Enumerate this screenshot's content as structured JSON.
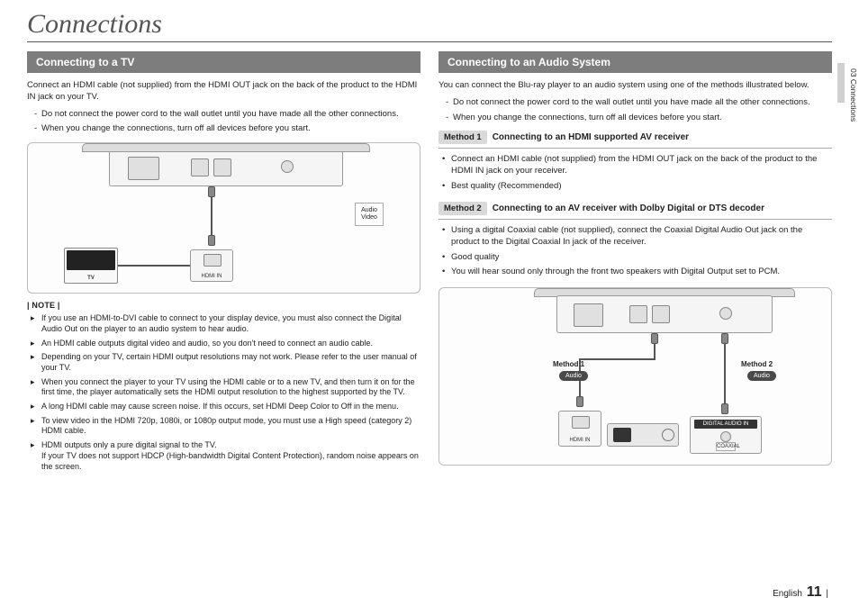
{
  "title": "Connections",
  "side_tab": "03  Connections",
  "footer": {
    "lang": "English",
    "page": "11",
    "bar": "|"
  },
  "left": {
    "header": "Connecting to a TV",
    "intro": "Connect an HDMI cable (not supplied) from the HDMI OUT jack on the back of the product to the HDMI IN jack on your TV.",
    "dashes": [
      "Do not connect the power cord to the wall outlet until you have made all the other connections.",
      "When you change the connections, turn off all devices before you start."
    ],
    "diagram": {
      "audio_video": "Audio\nVideo",
      "tv_label": "TV",
      "hdmi_in": "HDMI IN"
    },
    "note_label": "| NOTE |",
    "notes": [
      "If you use an HDMI-to-DVI cable to connect to your display device, you must also connect the Digital Audio Out on the player to an audio system to hear audio.",
      "An HDMI cable outputs digital video and audio, so you don't need to connect an audio cable.",
      "Depending on your TV, certain HDMI output resolutions may not work. Please refer to the user manual of your TV.",
      "When you connect the player to your TV using the HDMI cable or to a new TV, and then turn it on for the first time, the player automatically sets the HDMI output resolution to the highest supported by the TV.",
      "A long HDMI cable may cause screen noise. If this occurs, set HDMI Deep Color to Off in the menu.",
      "To view video in the HDMI 720p, 1080i, or 1080p output mode, you must use a High speed (category 2) HDMI cable.",
      "HDMI outputs only a pure digital signal to the TV.\nIf your TV does not support HDCP (High-bandwidth Digital Content Protection), random noise appears on the screen."
    ]
  },
  "right": {
    "header": "Connecting to an Audio System",
    "intro": "You can connect the Blu-ray player to an audio system using one of the methods illustrated below.",
    "dashes": [
      "Do not connect the power cord to the wall outlet until you have made all the other connections.",
      "When you change the connections, turn off all devices before you start."
    ],
    "method1": {
      "badge": "Method 1",
      "title": "Connecting to an HDMI supported AV receiver",
      "bullets": [
        "Connect an HDMI cable (not supplied) from the HDMI OUT jack on the back of the product to the HDMI IN jack on your receiver.",
        "Best quality (Recommended)"
      ]
    },
    "method2": {
      "badge": "Method 2",
      "title": "Connecting to an AV receiver with Dolby Digital or DTS decoder",
      "bullets": [
        "Using a digital Coaxial cable (not supplied), connect the Coaxial Digital Audio Out jack on the product to the Digital Coaxial In jack of the receiver.",
        "Good quality",
        "You will hear sound only through the front two speakers with Digital Output set to PCM."
      ]
    },
    "diagram": {
      "m1_label": "Method 1",
      "m2_label": "Method 2",
      "audio1": "Audio",
      "audio2": "Audio",
      "hdmi_in": "HDMI IN",
      "dig_in_top": "DIGITAL AUDIO IN",
      "coaxial": "COAXIAL"
    }
  }
}
